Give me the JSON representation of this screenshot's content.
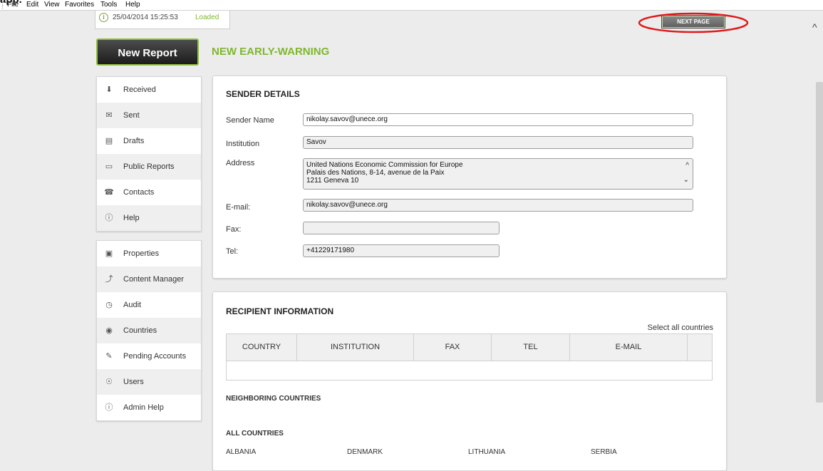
{
  "app": {
    "title": "app."
  },
  "menubar": {
    "items": [
      "File",
      "Edit",
      "View",
      "Favorites",
      "Tools",
      "Help"
    ]
  },
  "status": {
    "timestamp": "25/04/2014 15:25:53",
    "state": "Loaded"
  },
  "toolbar": {
    "next_page_label": "NEXT PAGE"
  },
  "new_report_label": "New Report",
  "page_heading": "NEW EARLY-WARNING",
  "nav_group1": [
    {
      "label": "Received",
      "icon": "download-icon"
    },
    {
      "label": "Sent",
      "icon": "envelope-icon"
    },
    {
      "label": "Drafts",
      "icon": "document-icon"
    },
    {
      "label": "Public Reports",
      "icon": "folder-icon"
    },
    {
      "label": "Contacts",
      "icon": "phone-icon"
    },
    {
      "label": "Help",
      "icon": "info-icon"
    }
  ],
  "nav_group2": [
    {
      "label": "Properties",
      "icon": "properties-icon"
    },
    {
      "label": "Content Manager",
      "icon": "wrench-icon"
    },
    {
      "label": "Audit",
      "icon": "clock-icon"
    },
    {
      "label": "Countries",
      "icon": "globe-icon"
    },
    {
      "label": "Pending Accounts",
      "icon": "pending-icon"
    },
    {
      "label": "Users",
      "icon": "user-icon"
    },
    {
      "label": "Admin Help",
      "icon": "info-icon"
    }
  ],
  "sender": {
    "title": "SENDER DETAILS",
    "fields": {
      "sender_name": {
        "label": "Sender Name",
        "value": "nikolay.savov@unece.org"
      },
      "institution": {
        "label": "Institution",
        "value": "Savov"
      },
      "address": {
        "label": "Address",
        "lines": [
          "United Nations Economic Commission for Europe",
          "Palais des Nations, 8-14, avenue de la Paix",
          "1211 Geneva 10"
        ]
      },
      "email": {
        "label": "E-mail:",
        "value": "nikolay.savov@unece.org"
      },
      "fax": {
        "label": "Fax:",
        "value": ""
      },
      "tel": {
        "label": "Tel:",
        "value": "+41229171980"
      }
    }
  },
  "recipient": {
    "title": "RECIPIENT INFORMATION",
    "select_all": "Select all countries",
    "columns": [
      "COUNTRY",
      "INSTITUTION",
      "FAX",
      "TEL",
      "E-MAIL"
    ],
    "neighboring_title": "NEIGHBORING COUNTRIES",
    "all_title": "ALL COUNTRIES",
    "countries": [
      "ALBANIA",
      "DENMARK",
      "LITHUANIA",
      "SERBIA"
    ]
  }
}
